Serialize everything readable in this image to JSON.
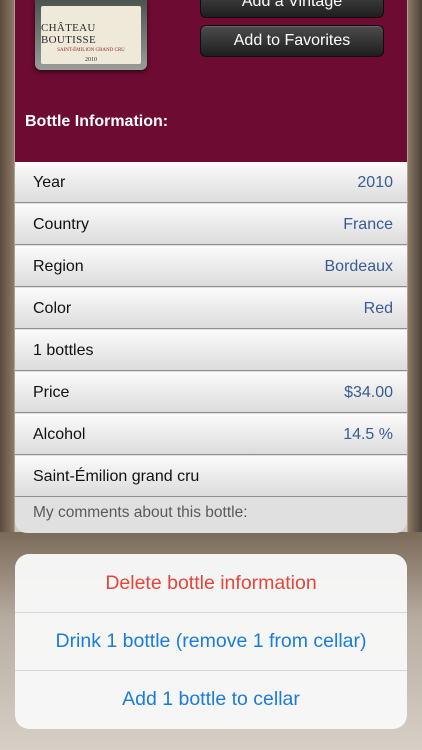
{
  "header": {
    "bottle_label_name": "CHÂTEAU BOUTISSE",
    "bottle_label_sub": "SAINT-ÉMILION GRAND CRU",
    "bottle_label_year": "2010",
    "add_vintage_label": "Add a Vintage",
    "add_favorites_label": "Add to Favorites",
    "section_title": "Bottle Information:"
  },
  "rows": [
    {
      "label": "Year",
      "value": "2010"
    },
    {
      "label": "Country",
      "value": "France"
    },
    {
      "label": "Region",
      "value": "Bordeaux"
    },
    {
      "label": "Color",
      "value": "Red"
    },
    {
      "label": "1 bottles",
      "value": ""
    },
    {
      "label": "Price",
      "value": "$34.00"
    },
    {
      "label": "Alcohol",
      "value": "14.5 %"
    },
    {
      "label": "Saint-Émilion grand cru",
      "value": ""
    }
  ],
  "comments_placeholder": "My comments about this bottle:",
  "action_sheet": {
    "delete_label": "Delete bottle information",
    "drink_label": "Drink 1 bottle (remove 1 from cellar)",
    "add_label": "Add 1 bottle to cellar"
  },
  "colors": {
    "header_bg": "#6e0b32",
    "value_text": "#3a5a93",
    "destructive": "#e5453b",
    "action": "#1a7cdd"
  }
}
